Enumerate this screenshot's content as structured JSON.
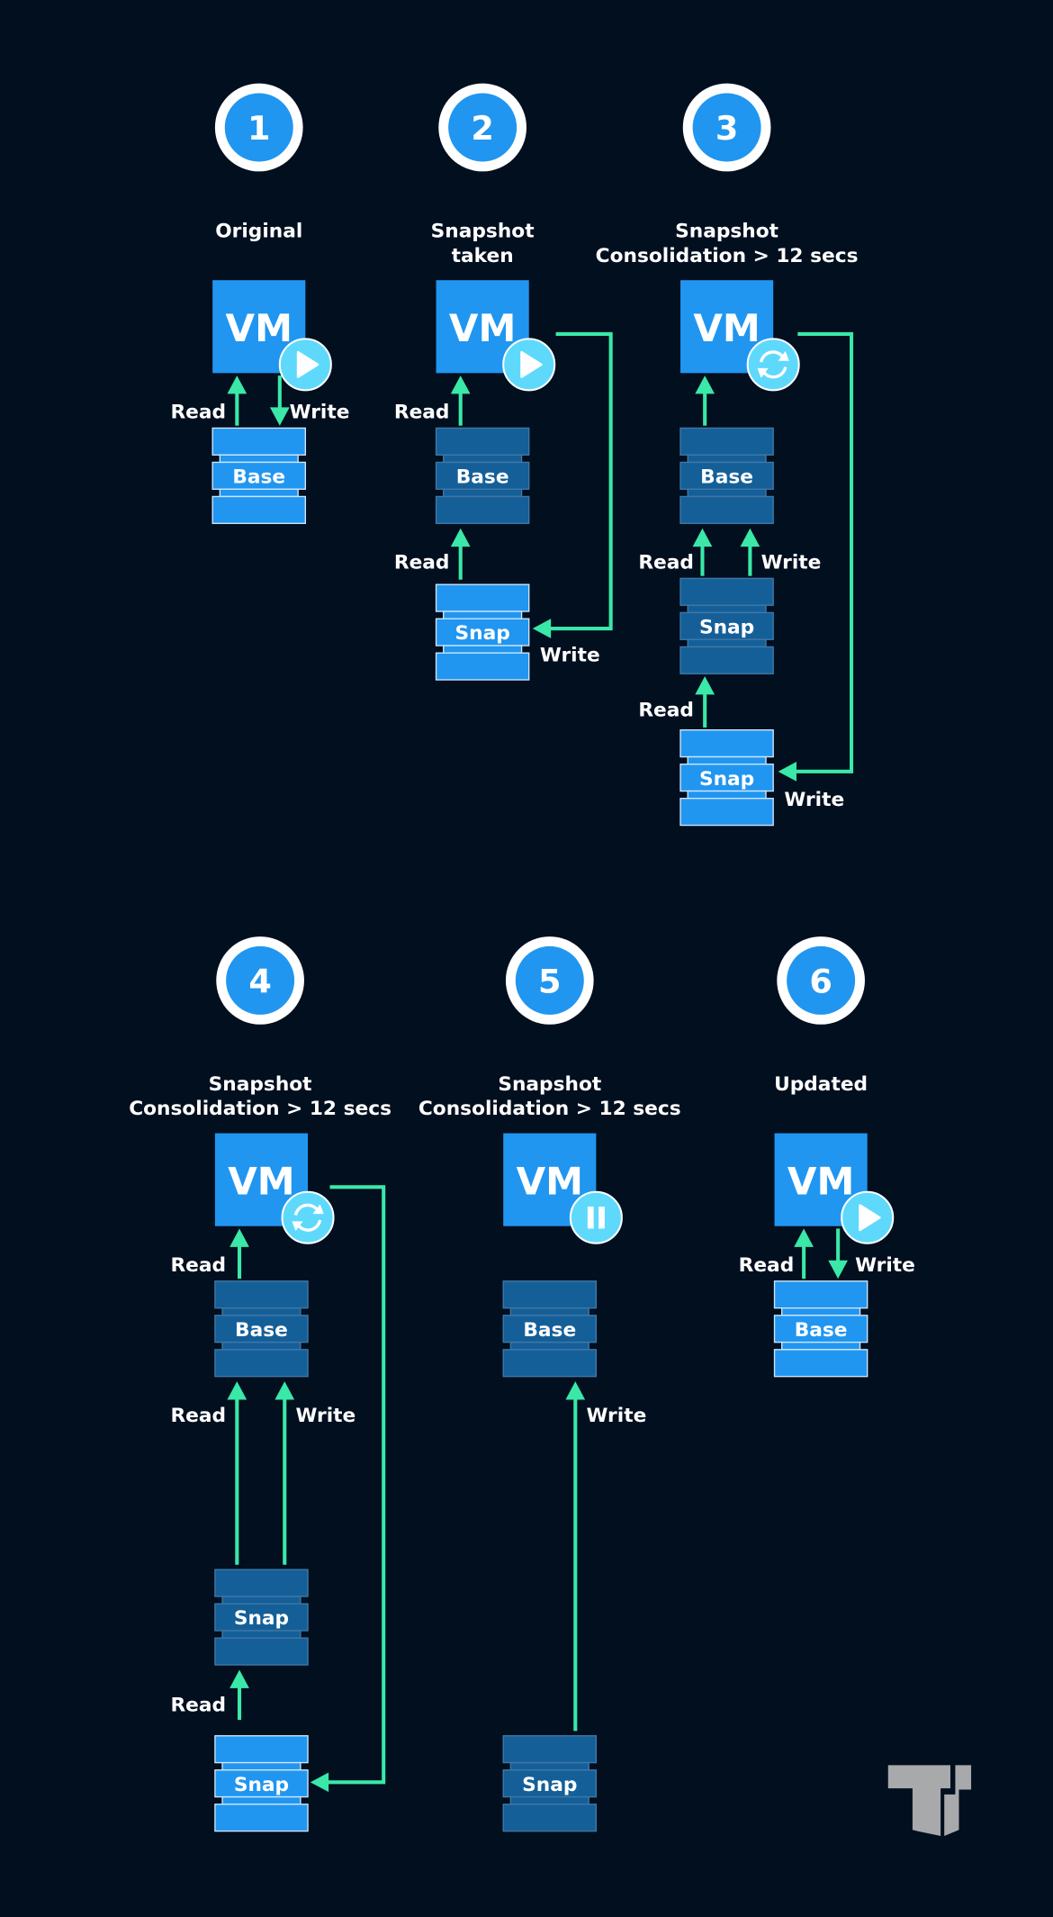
{
  "colors": {
    "background": "#020f1f",
    "active_blue": "#2196f0",
    "inactive_blue": "#155f99",
    "arrow_green": "#3ae8a8",
    "status_cyan": "#5ed9fb",
    "logo_gray": "#a8a9ab"
  },
  "panels": [
    {
      "step": "1",
      "title": [
        "Original"
      ],
      "vm_label": "VM",
      "vm_state": "play-icon",
      "disks": [
        {
          "label": "Base",
          "state": "active"
        }
      ],
      "labels": [
        "Read",
        "Write"
      ]
    },
    {
      "step": "2",
      "title": [
        "Snapshot",
        "taken"
      ],
      "vm_label": "VM",
      "vm_state": "play-icon",
      "disks": [
        {
          "label": "Base",
          "state": "inactive"
        },
        {
          "label": "Snap",
          "state": "active"
        }
      ],
      "labels": [
        "Read",
        "Read",
        "Write"
      ]
    },
    {
      "step": "3",
      "title": [
        "Snapshot",
        "Consolidation > 12 secs"
      ],
      "vm_label": "VM",
      "vm_state": "refresh-icon",
      "disks": [
        {
          "label": "Base",
          "state": "inactive"
        },
        {
          "label": "Snap",
          "state": "inactive"
        },
        {
          "label": "Snap",
          "state": "active"
        }
      ],
      "labels": [
        "Read",
        "Write",
        "Read",
        "Write"
      ]
    },
    {
      "step": "4",
      "title": [
        "Snapshot",
        "Consolidation > 12 secs"
      ],
      "vm_label": "VM",
      "vm_state": "refresh-icon",
      "disks": [
        {
          "label": "Base",
          "state": "inactive"
        },
        {
          "label": "Snap",
          "state": "inactive"
        },
        {
          "label": "Snap",
          "state": "active"
        }
      ],
      "labels": [
        "Read",
        "Read",
        "Write",
        "Read"
      ]
    },
    {
      "step": "5",
      "title": [
        "Snapshot",
        "Consolidation > 12 secs"
      ],
      "vm_label": "VM",
      "vm_state": "pause-icon",
      "disks": [
        {
          "label": "Base",
          "state": "inactive"
        },
        {
          "label": "Snap",
          "state": "inactive"
        }
      ],
      "labels": [
        "Write"
      ]
    },
    {
      "step": "6",
      "title": [
        "Updated"
      ],
      "vm_label": "VM",
      "vm_state": "play-icon",
      "disks": [
        {
          "label": "Base",
          "state": "active"
        }
      ],
      "labels": [
        "Read",
        "Write"
      ]
    }
  ],
  "logo": {
    "text": "TT",
    "icon": "brand-logo"
  }
}
